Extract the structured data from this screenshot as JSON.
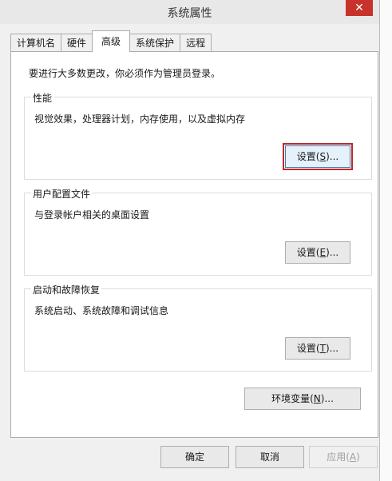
{
  "window": {
    "title": "系统属性",
    "close_glyph": "✕"
  },
  "tabs": [
    {
      "label": "计算机名"
    },
    {
      "label": "硬件"
    },
    {
      "label": "高级"
    },
    {
      "label": "系统保护"
    },
    {
      "label": "远程"
    }
  ],
  "panel": {
    "admin_note": "要进行大多数更改，你必须作为管理员登录。",
    "performance": {
      "title": "性能",
      "desc": "视觉效果，处理器计划，内存使用，以及虚拟内存",
      "button": {
        "pre": "设置(",
        "key": "S",
        "post": ")..."
      }
    },
    "user_profiles": {
      "title": "用户配置文件",
      "desc": "与登录帐户相关的桌面设置",
      "button": {
        "pre": "设置(",
        "key": "E",
        "post": ")..."
      }
    },
    "startup": {
      "title": "启动和故障恢复",
      "desc": "系统启动、系统故障和调试信息",
      "button": {
        "pre": "设置(",
        "key": "T",
        "post": ")..."
      }
    },
    "env_button": {
      "pre": "环境变量(",
      "key": "N",
      "post": ")..."
    }
  },
  "footer": {
    "ok": "确定",
    "cancel": "取消",
    "apply": {
      "pre": "应用(",
      "key": "A",
      "post": ")"
    }
  }
}
